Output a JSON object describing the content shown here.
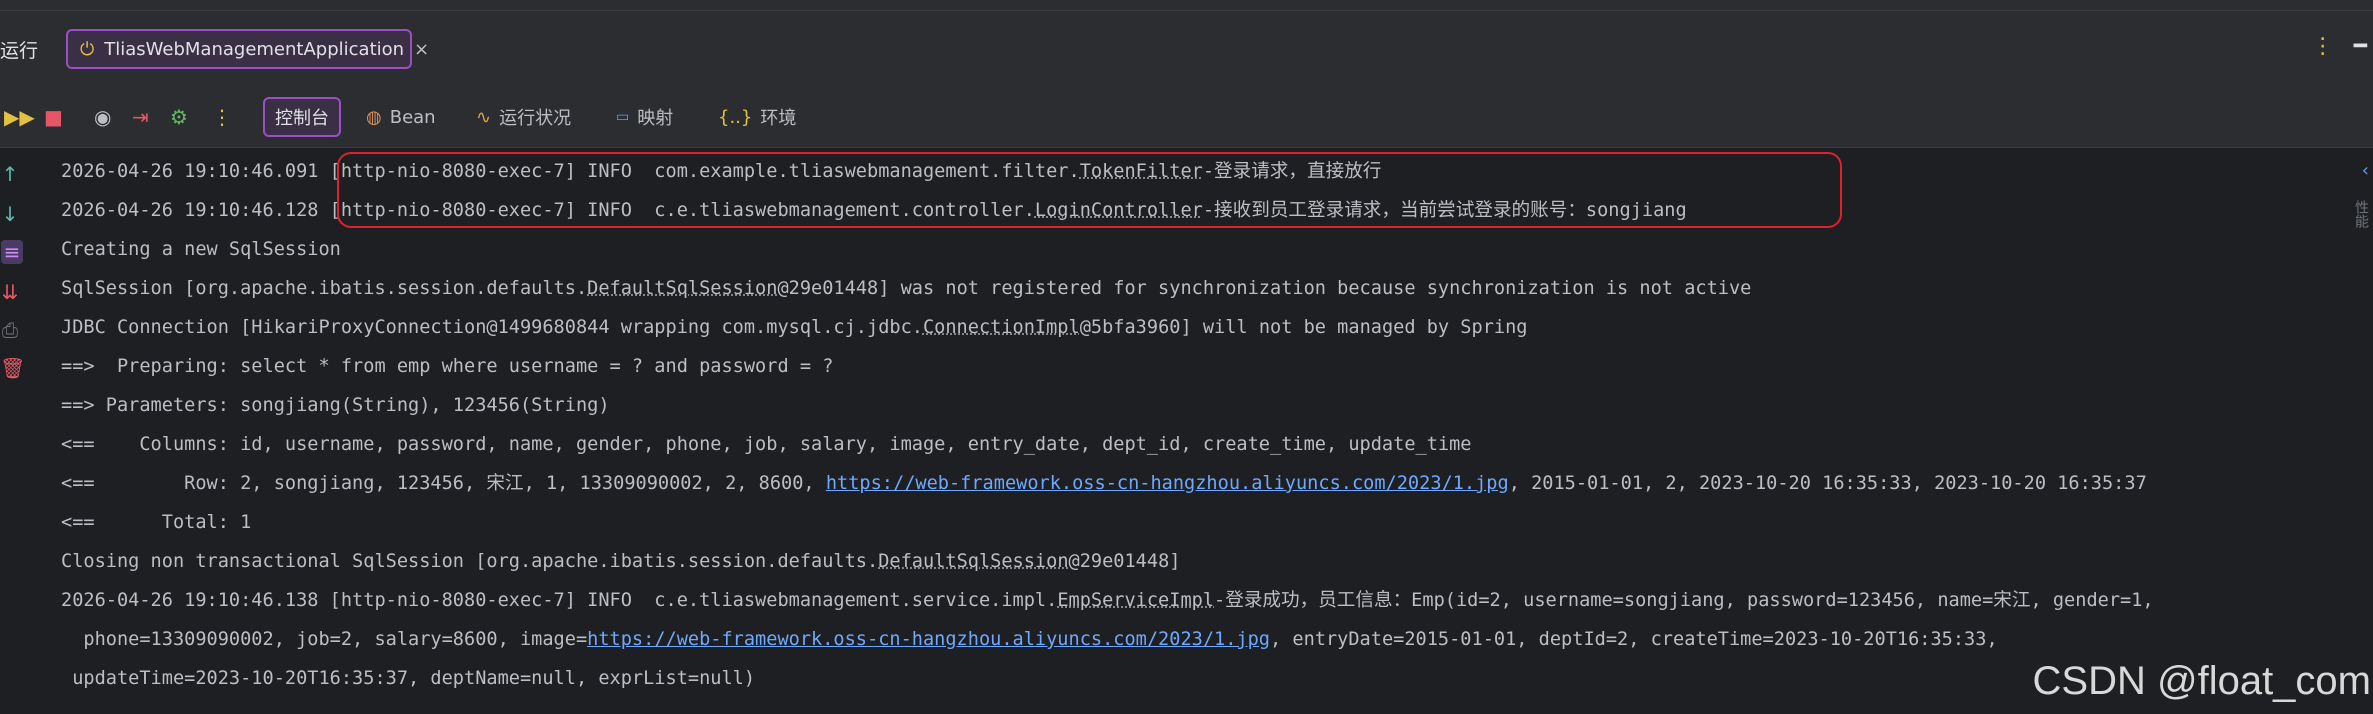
{
  "run_panel": {
    "label": "运行",
    "tab_title": "TliasWebManagementApplication",
    "close_glyph": "×"
  },
  "toolbar": {
    "tabs": [
      {
        "label": "控制台"
      },
      {
        "label": "Bean"
      },
      {
        "label": "运行状况"
      },
      {
        "label": "映射"
      },
      {
        "label": "环境"
      }
    ]
  },
  "console": {
    "lines": [
      [
        "2026-04-26 19:10:46.091 [http-nio-8080-exec-7] INFO  com.example.tliaswebmanagement.filter.",
        "TokenFilter",
        "-登录请求，直接放行"
      ],
      [
        "2026-04-26 19:10:46.128 [http-nio-8080-exec-7] INFO  c.e.tliaswebmanagement.controller.",
        "LoginController",
        "-接收到员工登录请求，当前尝试登录的账号：songjiang"
      ],
      [
        "Creating a new SqlSession"
      ],
      [
        "SqlSession [org.apache.ibatis.session.defaults.",
        "DefaultSqlSession",
        "@29e01448] was not registered for synchronization because synchronization is not active"
      ],
      [
        "JDBC Connection [HikariProxyConnection@1499680844 wrapping com.mysql.cj.jdbc.",
        "ConnectionImpl",
        "@5bfa3960] will not be managed by Spring"
      ],
      [
        "==>  Preparing: select * from emp where username = ? and password = ?"
      ],
      [
        "==> Parameters: songjiang(String), 123456(String)"
      ],
      [
        "<==    Columns: id, username, password, name, gender, phone, job, salary, image, entry_date, dept_id, create_time, update_time"
      ],
      [
        "<==        Row: 2, songjiang, 123456, 宋江, 1, 13309090002, 2, 8600, ",
        "https://web-framework.oss-cn-hangzhou.aliyuncs.com/2023/1.jpg",
        ", 2015-01-01, 2, 2023-10-20 16:35:33, 2023-10-20 16:35:37"
      ],
      [
        "<==      Total: 1"
      ],
      [
        "Closing non transactional SqlSession [org.apache.ibatis.session.defaults.",
        "DefaultSqlSession",
        "@29e01448]"
      ],
      [
        "2026-04-26 19:10:46.138 [http-nio-8080-exec-7] INFO  c.e.tliaswebmanagement.service.impl.",
        "EmpServiceImpl",
        "-登录成功，员工信息：Emp(id=2, username=songjiang, password=123456, name=宋江, gender=1,"
      ],
      [
        "  phone=13309090002, job=2, salary=8600, image=",
        "https://web-framework.oss-cn-hangzhou.aliyuncs.com/2023/1.jpg",
        ", entryDate=2015-01-01, deptId=2, createTime=2023-10-20T16:35:33,"
      ],
      [
        " updateTime=2023-10-20T16:35:37, deptName=null, exprList=null)"
      ]
    ]
  },
  "right_rail": {
    "label": "性能"
  },
  "watermark": "CSDN @float_com",
  "colors": {
    "accent": "#9a4fc4",
    "highlight_border": "#e0202a",
    "link": "#6fa8ff",
    "background": "#1e1f22"
  }
}
